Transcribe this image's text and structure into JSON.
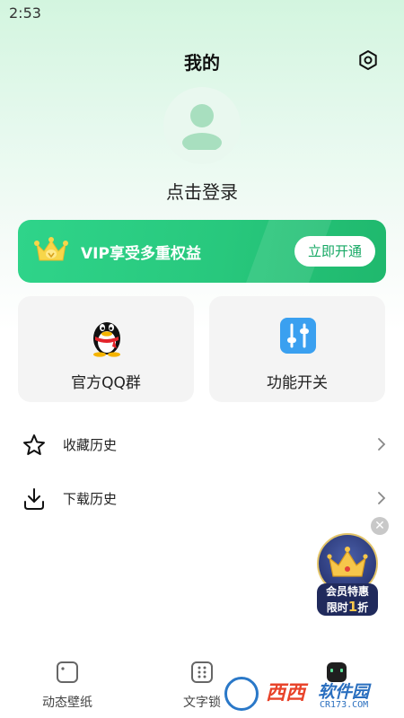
{
  "status_bar": {
    "time": "2:53"
  },
  "header": {
    "title": "我的",
    "settings_icon": "settings-icon"
  },
  "profile": {
    "avatar_icon": "user-avatar-icon",
    "login_text": "点击登录"
  },
  "vip_banner": {
    "text": "VIP享受多重权益",
    "button_label": "立即开通",
    "icon": "crown-icon"
  },
  "cards": [
    {
      "label": "官方QQ群",
      "icon": "qq-penguin-icon"
    },
    {
      "label": "功能开关",
      "icon": "toggle-sliders-icon"
    }
  ],
  "list": [
    {
      "label": "收藏历史",
      "icon": "star-icon"
    },
    {
      "label": "下载历史",
      "icon": "download-icon"
    }
  ],
  "promo": {
    "line1": "会员特惠",
    "line2_prefix": "限时",
    "line2_highlight": "1",
    "line2_suffix": "折",
    "close_glyph": "✕"
  },
  "tabbar": [
    {
      "label": "动态壁纸",
      "icon": "dynamic-wallpaper-icon"
    },
    {
      "label": "文字锁",
      "icon": "text-lock-icon"
    },
    {
      "label": "",
      "icon": "profile-tab-icon"
    }
  ],
  "watermark": {
    "text1": "西西",
    "text2": "软件园",
    "sub": "CR173.COM"
  },
  "colors": {
    "accent": "#28c87d",
    "vip_button_text": "#16a864",
    "promo_bg": "#202a5c",
    "promo_gold": "#f6c64b"
  }
}
